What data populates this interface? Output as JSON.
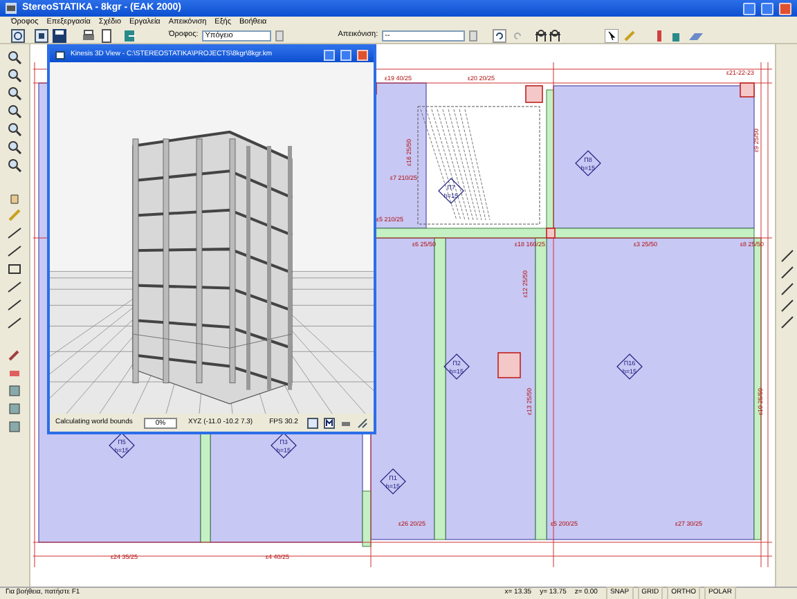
{
  "window": {
    "title": "StereoSTATIKA - 8kgr - (EAK 2000)"
  },
  "menu": [
    "Όροφος",
    "Επεξεργασία",
    "Σχέδιο",
    "Εργαλεία",
    "Απεικόνιση",
    "Εξής",
    "Βοήθεια"
  ],
  "toolbar": {
    "floor_label": "Όροφος:",
    "floor_value": "Υπόγειο",
    "view_label": "Απεικόνιση:",
    "view_value": "--"
  },
  "viewer": {
    "title": "Kinesis 3D View - C:\\STEREOSTATIKA\\PROJECTS\\8kgr\\8kgr.km",
    "status": "Calculating world bounds",
    "progress": "0%",
    "xyz": "XYZ (-11.0 -10.2 7.3)",
    "fps": "FPS 30.2"
  },
  "plan": {
    "beam_labels": [
      {
        "text": "ε19 40/25"
      },
      {
        "text": "ε20 20/25"
      },
      {
        "text": "ε21-22-23"
      },
      {
        "text": "ε7 210/25"
      },
      {
        "text": "ε5 210/25"
      },
      {
        "text": "ε6 25/50"
      },
      {
        "text": "ε18 160/25"
      },
      {
        "text": "ε3 25/50"
      },
      {
        "text": "ε8 25/50"
      },
      {
        "text": "ε16 25/50"
      },
      {
        "text": "ε13 25/50"
      },
      {
        "text": "ε12 25/50"
      },
      {
        "text": "ε9 25/50"
      },
      {
        "text": "ε10 25/50"
      },
      {
        "text": "ε26 20/25"
      },
      {
        "text": "ε5 200/25"
      },
      {
        "text": "ε27 30/25"
      },
      {
        "text": "ε24 35/25"
      },
      {
        "text": "ε4 40/25"
      }
    ],
    "slabs": [
      {
        "name": "Π5",
        "thickness": "h=15"
      },
      {
        "name": "Π3",
        "thickness": "h=15"
      },
      {
        "name": "Π2",
        "thickness": "h=15"
      },
      {
        "name": "Π7",
        "thickness": "h=15"
      },
      {
        "name": "Π8",
        "thickness": "h=15"
      },
      {
        "name": "Π16",
        "thickness": "h=15"
      },
      {
        "name": "Π1",
        "thickness": "h=15"
      }
    ]
  },
  "status_bar": {
    "hint": "Για βοήθεια, πατήστε F1",
    "x": "x= 13.35",
    "y": "y= 13.75",
    "z": "z= 0.00",
    "toggles": [
      {
        "label": "SNAP",
        "on": false
      },
      {
        "label": "GRID",
        "on": false
      },
      {
        "label": "ORTHO",
        "on": false
      },
      {
        "label": "POLAR",
        "on": false
      }
    ]
  }
}
